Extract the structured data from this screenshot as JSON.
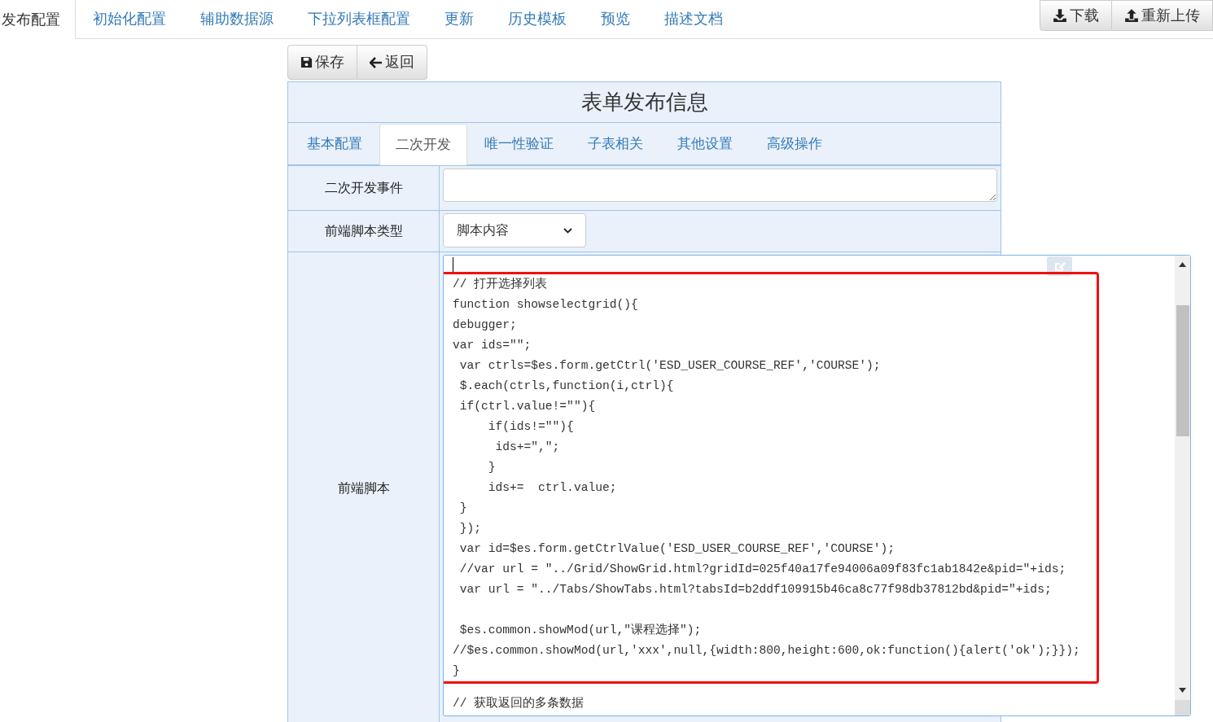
{
  "top_tabs": [
    {
      "label": "发布配置",
      "selected": true
    },
    {
      "label": "初始化配置",
      "selected": false
    },
    {
      "label": "辅助数据源",
      "selected": false
    },
    {
      "label": "下拉列表框配置",
      "selected": false
    },
    {
      "label": "更新",
      "selected": false
    },
    {
      "label": "历史模板",
      "selected": false
    },
    {
      "label": "预览",
      "selected": false
    },
    {
      "label": "描述文档",
      "selected": false
    }
  ],
  "top_buttons": [
    {
      "label": "下载",
      "kind": "download"
    },
    {
      "label": "重新上传",
      "kind": "upload"
    }
  ],
  "toolbar": [
    {
      "label": "保存",
      "kind": "save"
    },
    {
      "label": "返回",
      "kind": "back"
    }
  ],
  "panel": {
    "title": "表单发布信息",
    "tabs": [
      {
        "label": "基本配置",
        "selected": false
      },
      {
        "label": "二次开发",
        "selected": true
      },
      {
        "label": "唯一性验证",
        "selected": false
      },
      {
        "label": "子表相关",
        "selected": false
      },
      {
        "label": "其他设置",
        "selected": false
      },
      {
        "label": "高级操作",
        "selected": false
      }
    ],
    "fields": [
      {
        "label": "二次开发事件",
        "kind": "textarea"
      },
      {
        "label": "前端脚本类型",
        "kind": "select",
        "value": "脚本内容"
      },
      {
        "label": "前端脚本",
        "kind": "code"
      }
    ]
  },
  "highlighted_code": "// 打开选择列表\nfunction showselectgrid(){\ndebugger;\nvar ids=\"\";\n var ctrls=$es.form.getCtrl('ESD_USER_COURSE_REF','COURSE');\n $.each(ctrls,function(i,ctrl){\n if(ctrl.value!=\"\"){\n     if(ids!=\"\"){\n      ids+=\",\";\n     }\n     ids+=  ctrl.value;\n }\n });\n var id=$es.form.getCtrlValue('ESD_USER_COURSE_REF','COURSE');\n //var url = \"../Grid/ShowGrid.html?gridId=025f40a17fe94006a09f83fc1ab1842e&pid=\"+ids;\n var url = \"../Tabs/ShowTabs.html?tabsId=b2ddf109915b46ca8c77f98db37812bd&pid=\"+ids;\n\n $es.common.showMod(url,\"课程选择\");\n//$es.common.showMod(url,'xxx',null,{width:800,height:600,ok:function(){alert('ok');}});\n}",
  "code_after": "// 获取返回的多条数据"
}
